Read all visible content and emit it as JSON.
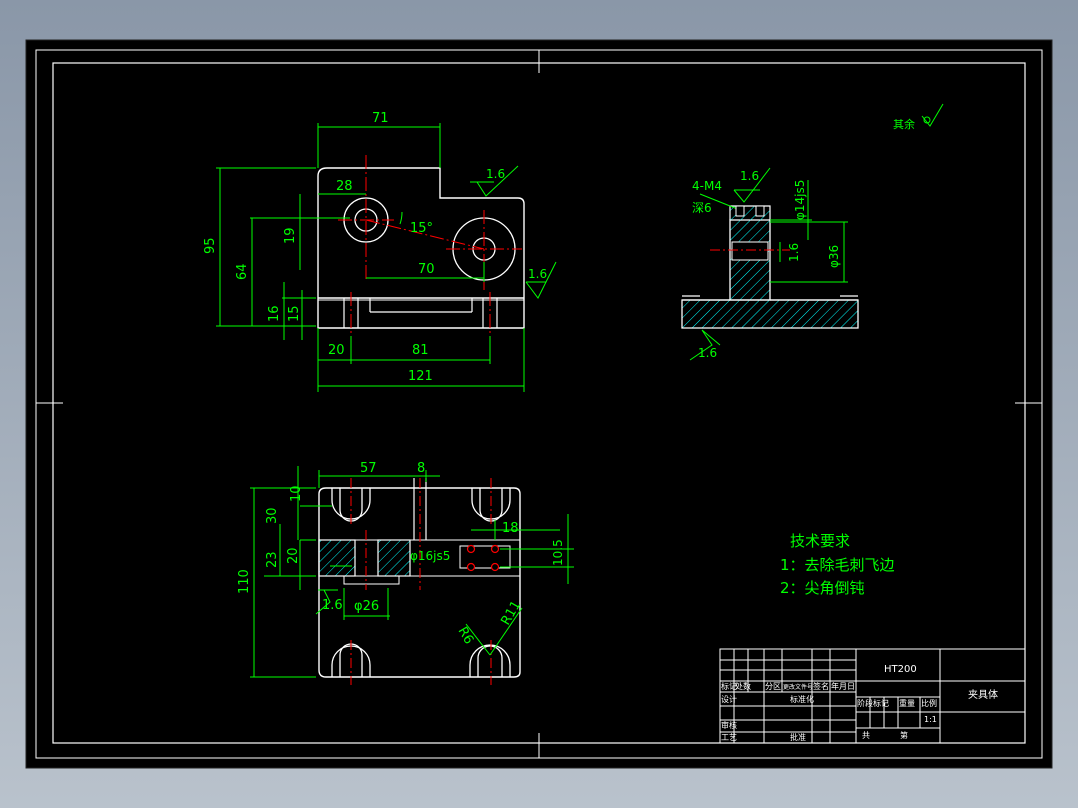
{
  "drawing": {
    "colors": {
      "background": "#000000",
      "frame": "#ffffff",
      "outline": "#ffffff",
      "dimension": "#00ff00",
      "centerline": "#ff0000",
      "hatch": "#00ffff",
      "text_tech": "#00ff00"
    },
    "roughness_note": "其余",
    "front_view_dims": {
      "d71": "71",
      "d28": "28",
      "d95": "95",
      "d64": "64",
      "d19": "19",
      "d15deg": "15°",
      "d70": "70",
      "d16": "16",
      "d15": "15",
      "d20": "20",
      "d81": "81",
      "d121": "121",
      "r1": "1.6",
      "r2": "1.6"
    },
    "side_view_dims": {
      "thread": "4-M4",
      "depth": "深6",
      "rough_top": "1.6",
      "fit": "φ14js5",
      "dia36": "φ36",
      "rough_side": "1.6",
      "rough_bottom": "1.6"
    },
    "top_view_dims": {
      "d57": "57",
      "d8": "8",
      "d10": "10",
      "d30": "30",
      "d23": "23",
      "d20": "20",
      "d110": "110",
      "d16js5": "φ16js5",
      "d18": "18",
      "d10_5": "10.5",
      "d26": "φ26",
      "rough": "1.6",
      "r6": "R6",
      "r11": "R11"
    },
    "tech_requirements": {
      "title": "技术要求",
      "item1": "1：去除毛刺飞边",
      "item2": "2：尖角倒钝"
    },
    "title_block": {
      "material": "HT200",
      "part_name": "夹具体",
      "scale": "1:1",
      "row_labels": [
        "标记",
        "处数",
        "分区",
        "更改文件号",
        "签名",
        "年月日"
      ],
      "designer": "设计",
      "standard": "标准化",
      "review": "审核",
      "process": "工艺",
      "approve": "批准",
      "stage": "阶段标记",
      "weight": "重量",
      "ratio": "比例",
      "sheets": "共",
      "sheet_no": "第"
    }
  }
}
